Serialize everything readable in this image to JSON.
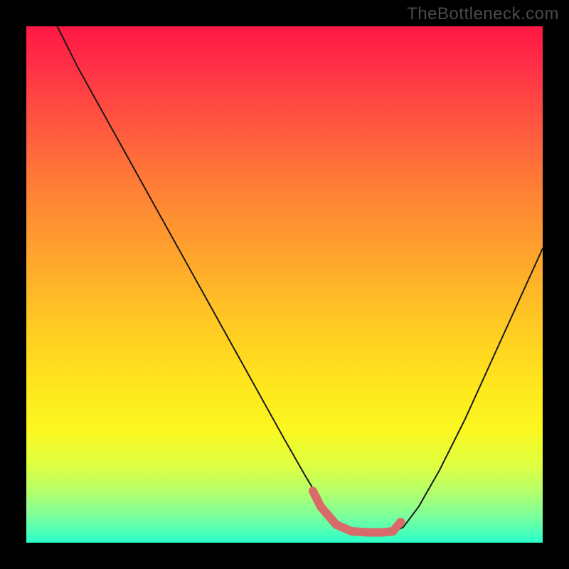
{
  "watermark": "TheBottleneck.com",
  "chart_data": {
    "type": "line",
    "title": "",
    "xlabel": "",
    "ylabel": "",
    "xlim": [
      0,
      100
    ],
    "ylim": [
      0,
      100
    ],
    "background_gradient": {
      "orientation": "vertical",
      "stops": [
        {
          "pos": 0,
          "color": "#ff1744"
        },
        {
          "pos": 20,
          "color": "#ff5a3f"
        },
        {
          "pos": 44,
          "color": "#ffa32c"
        },
        {
          "pos": 68,
          "color": "#ffe31e"
        },
        {
          "pos": 90,
          "color": "#b5ff6a"
        },
        {
          "pos": 100,
          "color": "#2affc9"
        }
      ]
    },
    "series": [
      {
        "name": "bottleneck-curve",
        "x": [
          6,
          10,
          15,
          20,
          25,
          30,
          35,
          40,
          45,
          50,
          54,
          57,
          60,
          63,
          66,
          69,
          71,
          73,
          76,
          80,
          85,
          90,
          95,
          100
        ],
        "y": [
          100,
          92,
          83,
          74,
          65,
          56,
          47,
          38,
          29,
          20,
          13,
          8,
          4,
          2.5,
          2,
          2,
          2,
          3,
          7,
          14,
          24,
          35,
          46,
          57
        ]
      }
    ],
    "annotations": [
      {
        "name": "optimal-range-marker",
        "color": "#d86a6a",
        "x": [
          55.5,
          57,
          60,
          63,
          66,
          69,
          71,
          72.5
        ],
        "y": [
          10,
          7,
          3.5,
          2.2,
          2,
          2,
          2.2,
          4
        ]
      }
    ]
  }
}
